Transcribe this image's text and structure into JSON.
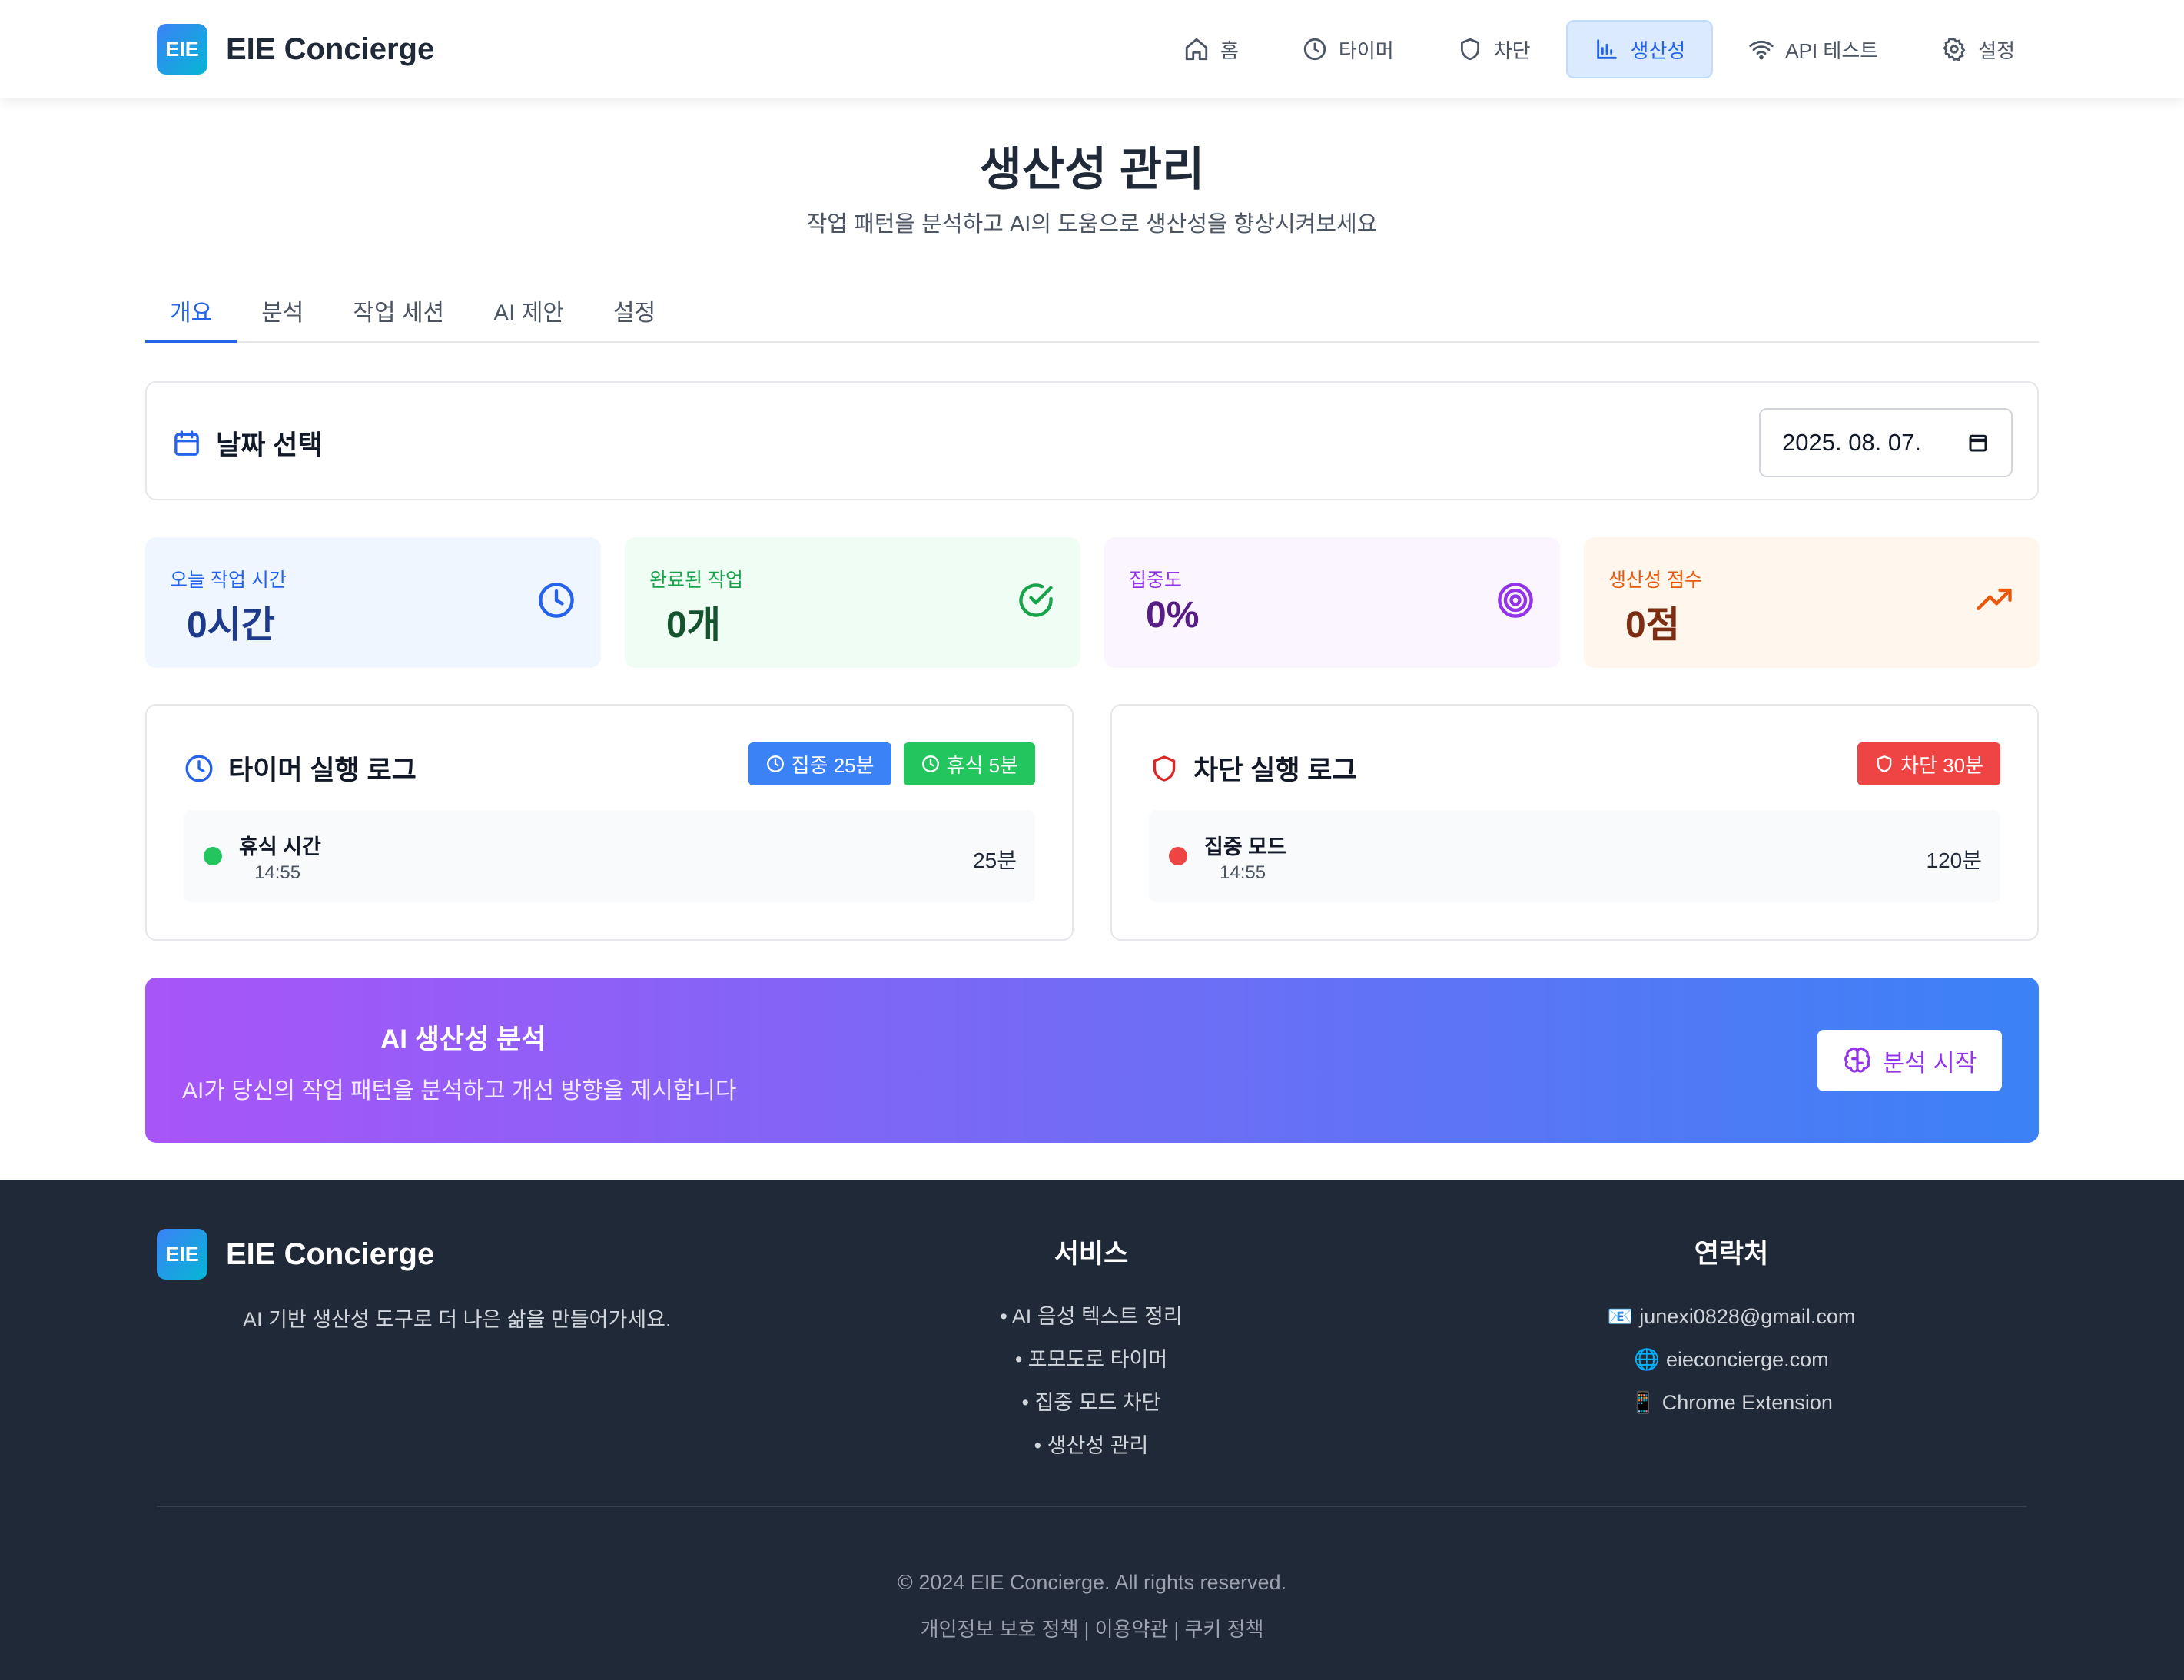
{
  "header": {
    "logo_text": "EIE",
    "brand": "EIE Concierge",
    "nav": [
      {
        "label": "홈",
        "icon": "home-icon"
      },
      {
        "label": "타이머",
        "icon": "clock-icon"
      },
      {
        "label": "차단",
        "icon": "shield-icon"
      },
      {
        "label": "생산성",
        "icon": "bar-chart-icon",
        "active": true
      },
      {
        "label": "API 테스트",
        "icon": "wifi-icon"
      },
      {
        "label": "설정",
        "icon": "gear-icon"
      }
    ]
  },
  "page": {
    "title": "생산성 관리",
    "subtitle": "작업 패턴을 분석하고 AI의 도움으로 생산성을 향상시켜보세요"
  },
  "tabs": [
    "개요",
    "분석",
    "작업 세션",
    "AI 제안",
    "설정"
  ],
  "date_picker": {
    "title": "날짜 선택",
    "value": "2025. 08. 07."
  },
  "stats": [
    {
      "label": "오늘 작업 시간",
      "value": "0시간",
      "icon": "clock-icon"
    },
    {
      "label": "완료된 작업",
      "value": "0개",
      "icon": "check-circle-icon"
    },
    {
      "label": "집중도",
      "value": "0%",
      "icon": "target-icon"
    },
    {
      "label": "생산성 점수",
      "value": "0점",
      "icon": "trending-up-icon"
    }
  ],
  "timer_log": {
    "title": "타이머 실행 로그",
    "badges": [
      "집중 25분",
      "휴식 5분"
    ],
    "entry": {
      "name": "휴식 시간",
      "time": "14:55",
      "duration": "25분"
    }
  },
  "block_log": {
    "title": "차단 실행 로그",
    "badges": [
      "차단 30분"
    ],
    "entry": {
      "name": "집중 모드",
      "time": "14:55",
      "duration": "120분"
    }
  },
  "ai_banner": {
    "title": "AI 생산성 분석",
    "description": "AI가 당신의 작업 패턴을 분석하고 개선 방향을 제시합니다",
    "button": "분석 시작"
  },
  "footer": {
    "logo_text": "EIE",
    "brand": "EIE Concierge",
    "tagline": "AI 기반 생산성 도구로 더 나은 삶을 만들어가세요.",
    "services_title": "서비스",
    "services": [
      "• AI 음성 텍스트 정리",
      "• 포모도로 타이머",
      "• 집중 모드 차단",
      "• 생산성 관리"
    ],
    "contact_title": "연락처",
    "contact": [
      {
        "icon": "📧",
        "text": "junexi0828@gmail.com"
      },
      {
        "icon": "🌐",
        "text": "eieconcierge.com"
      },
      {
        "icon": "📱",
        "text": "Chrome Extension"
      }
    ],
    "copyright": "© 2024 EIE Concierge. All rights reserved.",
    "links": "개인정보 보호 정책 | 이용약관 | 쿠키 정책"
  },
  "colors": {
    "primary": "#3b82f6",
    "active_nav_bg": "#dbeafe",
    "footer_bg": "#1f2937",
    "banner_gradient_start": "#a855f7",
    "banner_gradient_end": "#3b82f6"
  }
}
